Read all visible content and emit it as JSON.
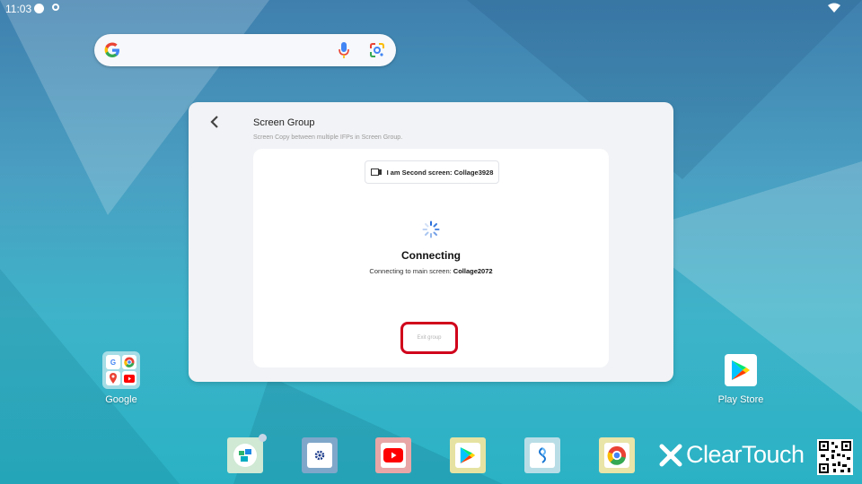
{
  "status_bar": {
    "time": "11:03"
  },
  "settings_panel": {
    "title": "Screen Group",
    "subtitle": "Screen Copy between multiple IFPs in Screen Group.",
    "device_chip": "I am Second screen: Collage3928",
    "status_title": "Connecting",
    "status_prefix": "Connecting to main screen: ",
    "main_screen_name": "Collage2072",
    "exit_label": "Exit group"
  },
  "desktop": {
    "folder_label": "Google",
    "play_store_label": "Play Store"
  },
  "branding": {
    "logo_text": "ClearTouch"
  },
  "colors": {
    "highlight": "#d0021b",
    "spinner": "#2a6fdb",
    "panel_bg": "#f2f3f6"
  }
}
